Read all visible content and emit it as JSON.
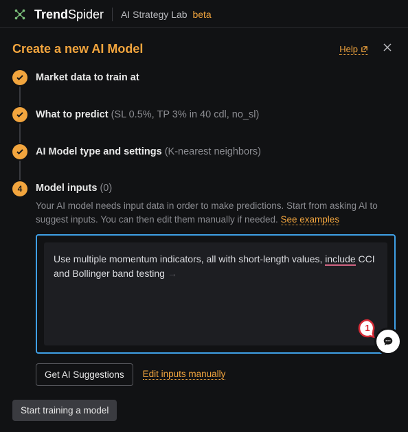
{
  "brand": {
    "part1": "Trend",
    "part2": "Spider",
    "lab": "AI Strategy Lab",
    "beta": "beta"
  },
  "panel": {
    "title": "Create a new AI Model",
    "help_label": "Help",
    "close_aria": "Close"
  },
  "steps": [
    {
      "title": "Market data to train at",
      "detail": "",
      "done": true
    },
    {
      "title": "What to predict",
      "detail": "(SL 0.5%, TP 3% in 40 cdl, no_sl)",
      "done": true
    },
    {
      "title": "AI Model type and settings",
      "detail": "(K-nearest neighbors)",
      "done": true
    }
  ],
  "active_step": {
    "number": "4",
    "title": "Model inputs",
    "count": "(0)",
    "help_text": "Your AI model needs input data in order to make predictions. Start from asking AI to suggest inputs. You can then edit them manually if needed.",
    "see_examples": "See examples",
    "input_pre": "Use multiple momentum indicators, all with short-length values, ",
    "input_underlined": "include",
    "input_post": " CCI and Bollinger band testing",
    "bubble_count": "1"
  },
  "actions": {
    "get_suggestions": "Get AI Suggestions",
    "edit_manually": "Edit inputs manually",
    "start_training": "Start training a model"
  }
}
